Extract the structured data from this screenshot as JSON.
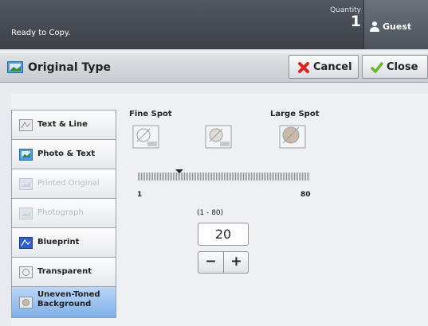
{
  "status_bar": {
    "status_text": "Ready to Copy.",
    "quantity_label": "Quantity",
    "quantity_value": "1",
    "user_label": "Guest"
  },
  "title_bar": {
    "title": "Original Type",
    "cancel_label": "Cancel",
    "close_label": "Close"
  },
  "original_types": [
    {
      "label": "Text & Line",
      "state": "enabled"
    },
    {
      "label": "Photo & Text",
      "state": "enabled"
    },
    {
      "label": "Printed Original",
      "state": "disabled"
    },
    {
      "label": "Photograph",
      "state": "disabled"
    },
    {
      "label": "Blueprint",
      "state": "enabled"
    },
    {
      "label": "Transparent",
      "state": "enabled"
    },
    {
      "label_line1": "Uneven-Toned",
      "label_line2": "Background",
      "state": "selected"
    }
  ],
  "spot_adjust": {
    "fine_label": "Fine Spot",
    "large_label": "Large Spot",
    "slider_min": "1",
    "slider_max": "80",
    "slider_value": 20,
    "range_label": "(1 - 80)",
    "value": "20",
    "minus_label": "−",
    "plus_label": "+"
  },
  "colors": {
    "topbar": "#3c4148",
    "selected_tab": "#7eb0ea",
    "cancel_icon": "#d7261e",
    "close_icon": "#6cb52d"
  }
}
